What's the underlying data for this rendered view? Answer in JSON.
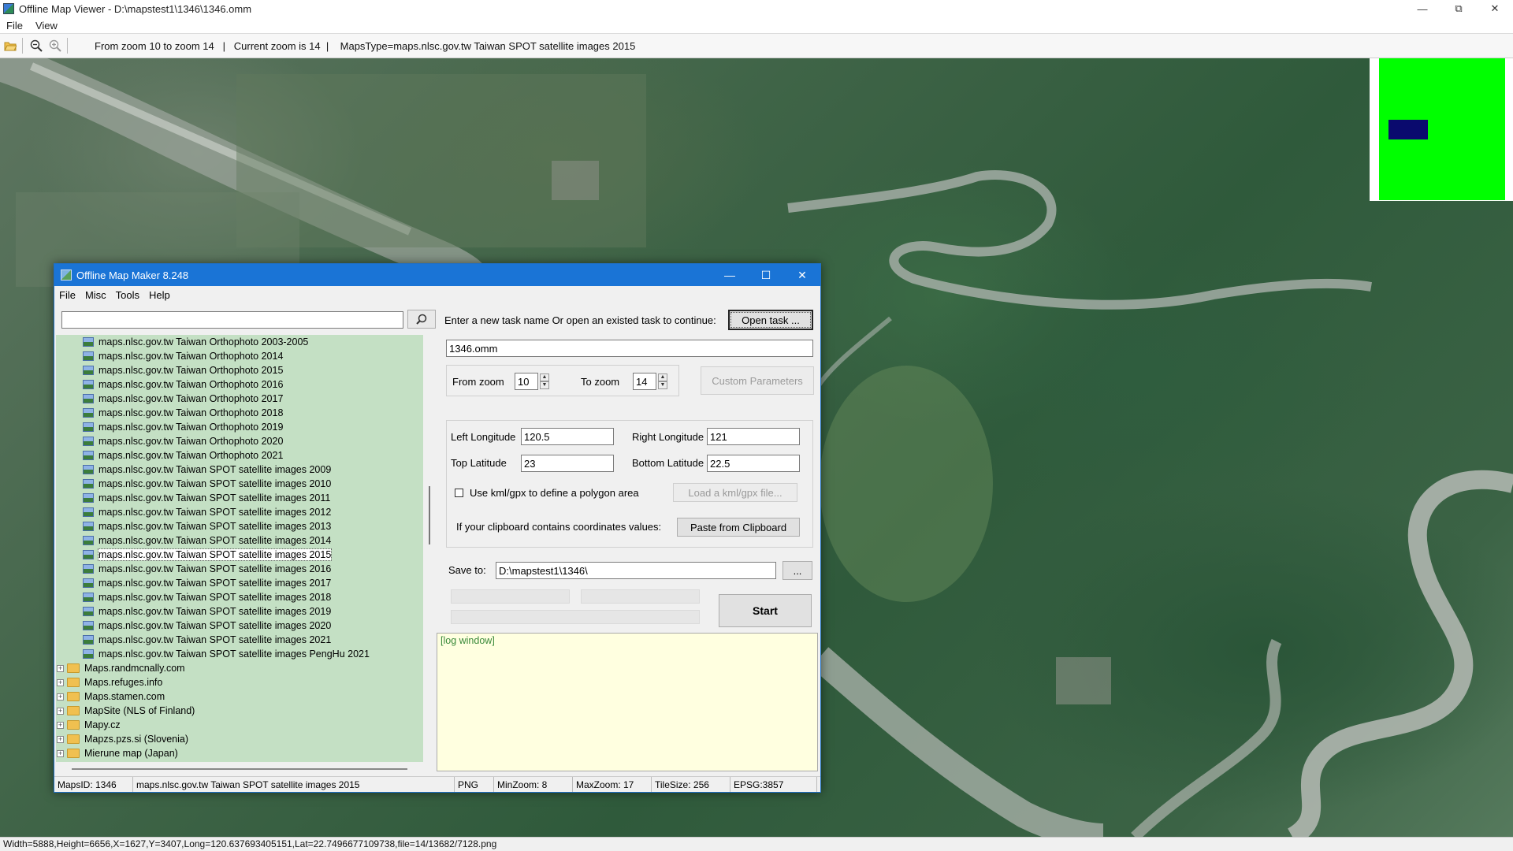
{
  "outer": {
    "title": "Offline Map Viewer - D:\\mapstest1\\1346\\1346.omm",
    "menu": [
      "File",
      "View"
    ],
    "zoom_info": "From zoom 10 to zoom 14   |   Current zoom is 14  |    MapsType=maps.nlsc.gov.tw Taiwan SPOT satellite images 2015",
    "status": "Width=5888,Height=6656,X=1627,Y=3407,Long=120.637693405151,Lat=22.7496677109738,file=14/13682/7128.png"
  },
  "icons": {
    "open": "open-folder-icon",
    "zoom_out": "zoom-out-icon",
    "zoom_in": "zoom-in-icon"
  },
  "colors": {
    "minimap_bg": "#00ff00",
    "minimap_view": "#0a0a6e",
    "tree_bg": "#c4e0c4",
    "title_blue": "#1a74d6",
    "log_bg": "#ffffe0"
  },
  "dialog": {
    "title": "Offline Map Maker 8.248",
    "menu": [
      "File",
      "Misc",
      "Tools",
      "Help"
    ],
    "search_value": "",
    "tree": [
      {
        "label": "maps.nlsc.gov.tw Taiwan Orthophoto 2003-2005",
        "kind": "leaf"
      },
      {
        "label": "maps.nlsc.gov.tw Taiwan Orthophoto 2014",
        "kind": "leaf"
      },
      {
        "label": "maps.nlsc.gov.tw Taiwan Orthophoto 2015",
        "kind": "leaf"
      },
      {
        "label": "maps.nlsc.gov.tw Taiwan Orthophoto 2016",
        "kind": "leaf"
      },
      {
        "label": "maps.nlsc.gov.tw Taiwan Orthophoto 2017",
        "kind": "leaf"
      },
      {
        "label": "maps.nlsc.gov.tw Taiwan Orthophoto 2018",
        "kind": "leaf"
      },
      {
        "label": "maps.nlsc.gov.tw Taiwan Orthophoto 2019",
        "kind": "leaf"
      },
      {
        "label": "maps.nlsc.gov.tw Taiwan Orthophoto 2020",
        "kind": "leaf"
      },
      {
        "label": "maps.nlsc.gov.tw Taiwan Orthophoto 2021",
        "kind": "leaf"
      },
      {
        "label": "maps.nlsc.gov.tw Taiwan SPOT satellite images 2009",
        "kind": "leaf"
      },
      {
        "label": "maps.nlsc.gov.tw Taiwan SPOT satellite images 2010",
        "kind": "leaf"
      },
      {
        "label": "maps.nlsc.gov.tw Taiwan SPOT satellite images 2011",
        "kind": "leaf"
      },
      {
        "label": "maps.nlsc.gov.tw Taiwan SPOT satellite images 2012",
        "kind": "leaf"
      },
      {
        "label": "maps.nlsc.gov.tw Taiwan SPOT satellite images 2013",
        "kind": "leaf"
      },
      {
        "label": "maps.nlsc.gov.tw Taiwan SPOT satellite images 2014",
        "kind": "leaf"
      },
      {
        "label": "maps.nlsc.gov.tw Taiwan SPOT satellite images 2015",
        "kind": "leaf",
        "selected": true
      },
      {
        "label": "maps.nlsc.gov.tw Taiwan SPOT satellite images 2016",
        "kind": "leaf"
      },
      {
        "label": "maps.nlsc.gov.tw Taiwan SPOT satellite images 2017",
        "kind": "leaf"
      },
      {
        "label": "maps.nlsc.gov.tw Taiwan SPOT satellite images 2018",
        "kind": "leaf"
      },
      {
        "label": "maps.nlsc.gov.tw Taiwan SPOT satellite images 2019",
        "kind": "leaf"
      },
      {
        "label": "maps.nlsc.gov.tw Taiwan SPOT satellite images 2020",
        "kind": "leaf"
      },
      {
        "label": "maps.nlsc.gov.tw Taiwan SPOT satellite images 2021",
        "kind": "leaf"
      },
      {
        "label": "maps.nlsc.gov.tw Taiwan SPOT satellite images PengHu 2021",
        "kind": "leaf"
      },
      {
        "label": "Maps.randmcnally.com",
        "kind": "folder"
      },
      {
        "label": "Maps.refuges.info",
        "kind": "folder"
      },
      {
        "label": "Maps.stamen.com",
        "kind": "folder"
      },
      {
        "label": "MapSite (NLS of Finland)",
        "kind": "folder"
      },
      {
        "label": "Mapy.cz",
        "kind": "folder"
      },
      {
        "label": "Mapzs.pzs.si (Slovenia)",
        "kind": "folder"
      },
      {
        "label": "Mierune map (Japan)",
        "kind": "folder"
      }
    ],
    "task_prompt": "Enter a new task name Or open an existed task to continue:",
    "open_task_label": "Open task ...",
    "task_name": "1346.omm",
    "from_zoom_label": "From zoom",
    "from_zoom": "10",
    "to_zoom_label": "To zoom",
    "to_zoom": "14",
    "custom_params_label": "Custom Parameters",
    "left_lon_label": "Left Longitude",
    "left_lon": "120.5",
    "right_lon_label": "Right Longitude",
    "right_lon": "121",
    "top_lat_label": "Top Latitude",
    "top_lat": "23",
    "bottom_lat_label": "Bottom Latitude",
    "bottom_lat": "22.5",
    "kml_label": "Use kml/gpx to define a polygon area",
    "load_kml_label": "Load a kml/gpx file...",
    "clipboard_prompt": "If your clipboard contains coordinates values:",
    "paste_label": "Paste from Clipboard",
    "save_to_label": "Save to:",
    "save_to": "D:\\mapstest1\\1346\\",
    "browse_label": "...",
    "start_label": "Start",
    "log_text": "[log window]",
    "status": {
      "maps_id": "MapsID: 1346",
      "maps_name": "maps.nlsc.gov.tw Taiwan SPOT satellite images 2015",
      "format": "PNG",
      "min_zoom": "MinZoom: 8",
      "max_zoom": "MaxZoom: 17",
      "tile_size": "TileSize: 256",
      "epsg": "EPSG:3857"
    }
  }
}
